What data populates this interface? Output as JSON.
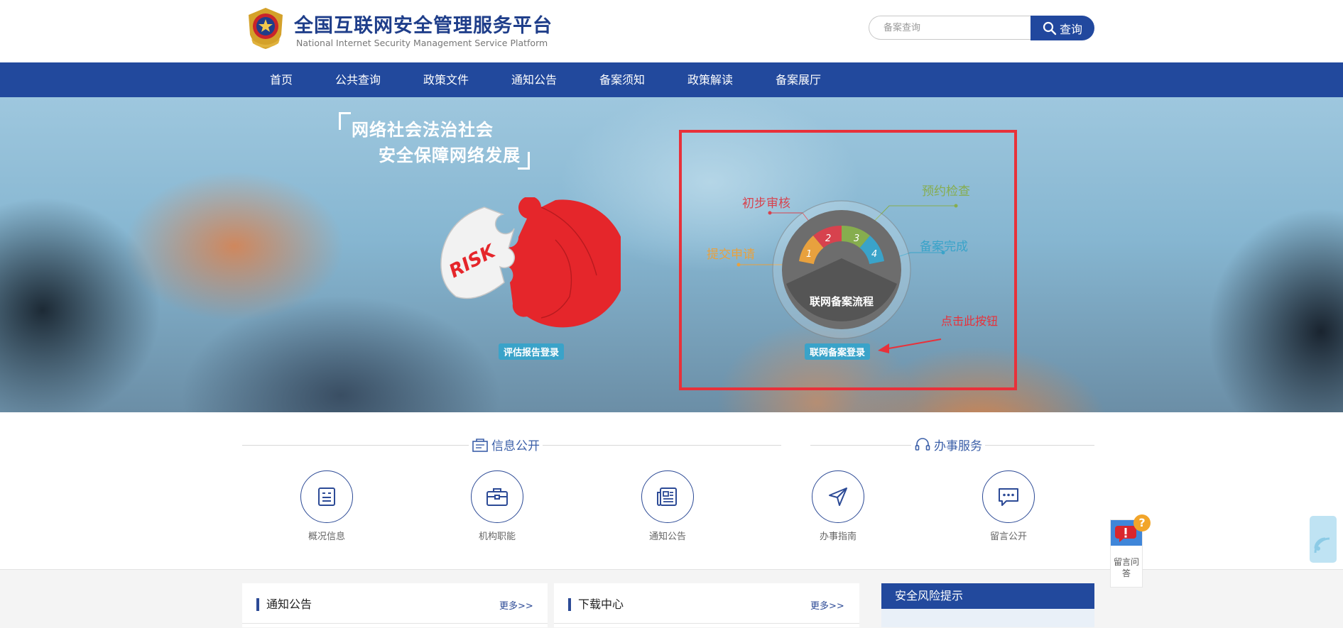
{
  "header": {
    "title_cn": "全国互联网安全管理服务平台",
    "title_en": "National Internet Security Management Service Platform",
    "search_placeholder": "备案查询",
    "search_button": "查询"
  },
  "nav": {
    "items": [
      {
        "label": "首页"
      },
      {
        "label": "公共查询"
      },
      {
        "label": "政策文件"
      },
      {
        "label": "通知公告"
      },
      {
        "label": "备案须知"
      },
      {
        "label": "政策解读"
      },
      {
        "label": "备案展厅"
      }
    ]
  },
  "banner": {
    "slogan_line1": "网络社会法治社会",
    "slogan_line2": "安全保障网络发展",
    "puzzle_text": "RISK",
    "eval_login": "评估报告登录",
    "flow_title": "联网备案流程",
    "flow_steps": [
      {
        "num": "1",
        "label": "提交申请",
        "color": "#e8a13e"
      },
      {
        "num": "2",
        "label": "初步审核",
        "color": "#d7424e"
      },
      {
        "num": "3",
        "label": "预约检查",
        "color": "#86ad4e"
      },
      {
        "num": "4",
        "label": "备案完成",
        "color": "#3aa3c9"
      }
    ],
    "icp_login": "联网备案登录",
    "click_hint": "点击此按钮"
  },
  "services": {
    "info_title": "信息公开",
    "service_title": "办事服务",
    "items": [
      {
        "label": "概况信息",
        "icon": "document-list-icon"
      },
      {
        "label": "机构职能",
        "icon": "briefcase-icon"
      },
      {
        "label": "通知公告",
        "icon": "newspaper-icon"
      },
      {
        "label": "办事指南",
        "icon": "paper-plane-icon"
      },
      {
        "label": "留言公开",
        "icon": "chat-bubble-icon"
      }
    ]
  },
  "panels": {
    "notice_title": "通知公告",
    "notice_more": "更多>>",
    "download_title": "下载中心",
    "download_more": "更多>>",
    "risk_title": "安全风险提示"
  },
  "float": {
    "message_label": "留言问答",
    "badge": "?"
  },
  "colors": {
    "brand_blue": "#22499d",
    "highlight_red": "#e8313a",
    "tag_blue": "#3aa3c9"
  }
}
